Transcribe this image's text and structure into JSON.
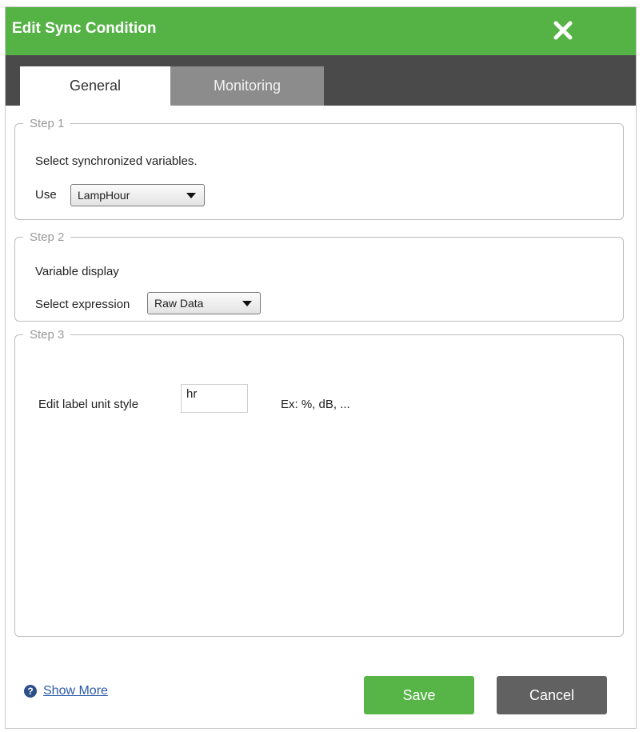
{
  "dialog": {
    "title": "Edit Sync Condition",
    "close_icon": "close-icon"
  },
  "tabs": [
    {
      "label": "General",
      "active": true
    },
    {
      "label": "Monitoring",
      "active": false
    }
  ],
  "step1": {
    "legend": "Step 1",
    "description": "Select synchronized variables.",
    "use_label": "Use",
    "use_selected": "LampHour"
  },
  "step2": {
    "legend": "Step 2",
    "description": "Variable display",
    "expression_label": "Select expression",
    "expression_selected": "Raw Data"
  },
  "step3": {
    "legend": "Step 3",
    "unit_label": "Edit label unit style",
    "unit_value": "hr",
    "unit_hint": "Ex: %, dB, ..."
  },
  "footer": {
    "help_icon": "question-circle-icon",
    "show_more": "Show More",
    "save": "Save",
    "cancel": "Cancel"
  },
  "colors": {
    "titlebar": "#55b346",
    "tabbar": "#4a4a4a",
    "save_button": "#57b446",
    "cancel_button": "#616161"
  }
}
